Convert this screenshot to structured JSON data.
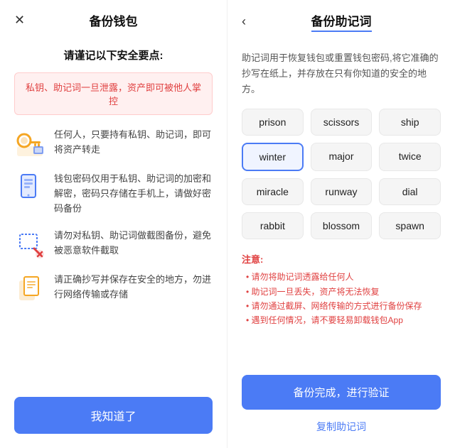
{
  "left": {
    "close_label": "✕",
    "title": "备份钱包",
    "safety_title": "请谨记以下安全要点:",
    "warning": "私钥、助记词一旦泄露，资产即可被他人掌控",
    "items": [
      {
        "icon": "🔑",
        "text": "任何人，只要持有私钥、助记词，即可将资产转走"
      },
      {
        "icon": "📱",
        "text": "钱包密码仅用于私钥、助记词的加密和解密，密码只存储在手机上，请做好密码备份"
      },
      {
        "icon": "📸",
        "text": "请勿对私钥、助记词做截图备份，避免被恶意软件截取"
      },
      {
        "icon": "📋",
        "text": "请正确抄写并保存在安全的地方，勿进行网络传输或存储"
      }
    ],
    "confirm_btn": "我知道了"
  },
  "right": {
    "back_label": "‹",
    "title": "备份助记词",
    "description": "助记词用于恢复钱包或重置钱包密码,将它准确的抄写在纸上，并存放在只有你知道的安全的地方。",
    "words": [
      "prison",
      "scissors",
      "ship",
      "winter",
      "major",
      "twice",
      "miracle",
      "runway",
      "dial",
      "rabbit",
      "blossom",
      "spawn"
    ],
    "highlighted_word": "winter",
    "notices": {
      "title": "注意:",
      "items": [
        "• 请勿将助记词透露给任何人",
        "• 助记词一旦丢失，资产将无法恢复",
        "• 请勿通过截屏、网络传输的方式进行备份保存",
        "• 遇到任何情况，请不要轻易卸载钱包App"
      ]
    },
    "backup_btn": "备份完成，进行验证",
    "copy_btn": "复制助记词"
  }
}
